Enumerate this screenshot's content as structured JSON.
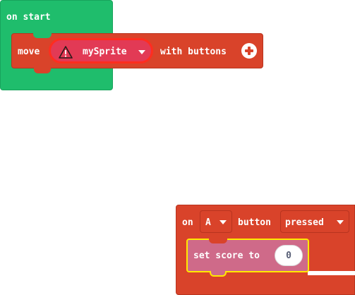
{
  "on_start": {
    "label": "on start",
    "color": "#1fbd6c"
  },
  "move_block": {
    "move_label": "move",
    "sprite_value": "mySprite",
    "with_label": "with buttons",
    "warning_icon": "warning-triangle-icon",
    "add_icon": "plus-circle-icon",
    "color": "#d9432a"
  },
  "event_block": {
    "on_label": "on",
    "button_value": "A",
    "button_label": "button",
    "event_value": "pressed",
    "color": "#d9432a"
  },
  "score_block": {
    "label": "set score to",
    "value": "0",
    "color": "#cf6a89",
    "highlight_color": "#ffea00"
  }
}
